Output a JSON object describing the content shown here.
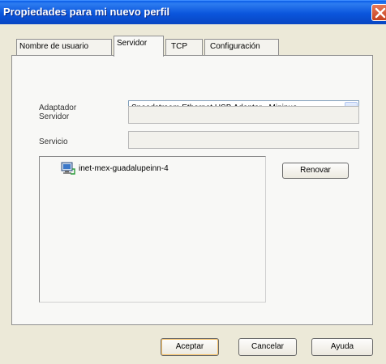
{
  "window": {
    "title": "Propiedades para mi nuevo perfil"
  },
  "tabs": [
    {
      "label": "Nombre de usuario",
      "active": false
    },
    {
      "label": "Servidor",
      "active": true
    },
    {
      "label": "TCP",
      "active": false
    },
    {
      "label": "Configuración",
      "active": false
    }
  ],
  "form": {
    "adapter_label": "Adaptador",
    "adapter_value": "Speedstream Ethernet USB Adapter - Minipue",
    "server_label": "Servidor",
    "server_value": "",
    "service_label": "Servicio",
    "service_value": ""
  },
  "list": {
    "items": [
      {
        "label": "inet-mex-guadalupeinn-4",
        "icon": "network-computer-icon"
      }
    ]
  },
  "buttons": {
    "refresh": "Renovar",
    "ok": "Aceptar",
    "cancel": "Cancelar",
    "help": "Ayuda"
  },
  "colors": {
    "titlebar": "#0a55dc",
    "close": "#c4411f",
    "dialog_bg": "#ece9d8"
  }
}
